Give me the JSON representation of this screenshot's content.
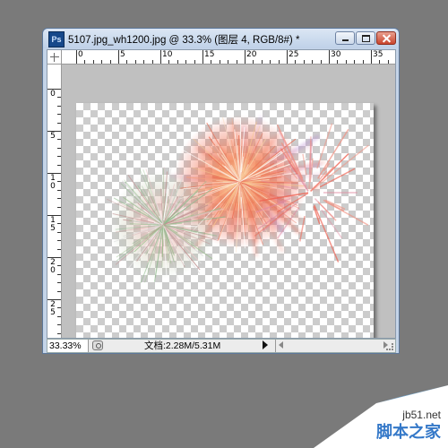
{
  "window": {
    "app_icon": "Ps",
    "title": "5107.jpg_wh1200.jpg @ 33.3% (图层 4, RGB/8#) *"
  },
  "ruler": {
    "top_labels": [
      "0",
      "5",
      "10",
      "15",
      "20",
      "25",
      "30",
      "35"
    ],
    "left_labels": [
      "0",
      "5",
      "10",
      "15",
      "20",
      "25"
    ]
  },
  "statusbar": {
    "zoom": "33.33%",
    "doc_info": "文档:2.28M/5.31M"
  },
  "watermark": {
    "site": "jb51.net",
    "name": "脚本之家"
  },
  "icons": [
    "photoshop-icon",
    "minimize-icon",
    "maximize-icon",
    "close-icon",
    "arrow-right-icon",
    "resize-grip-icon"
  ]
}
